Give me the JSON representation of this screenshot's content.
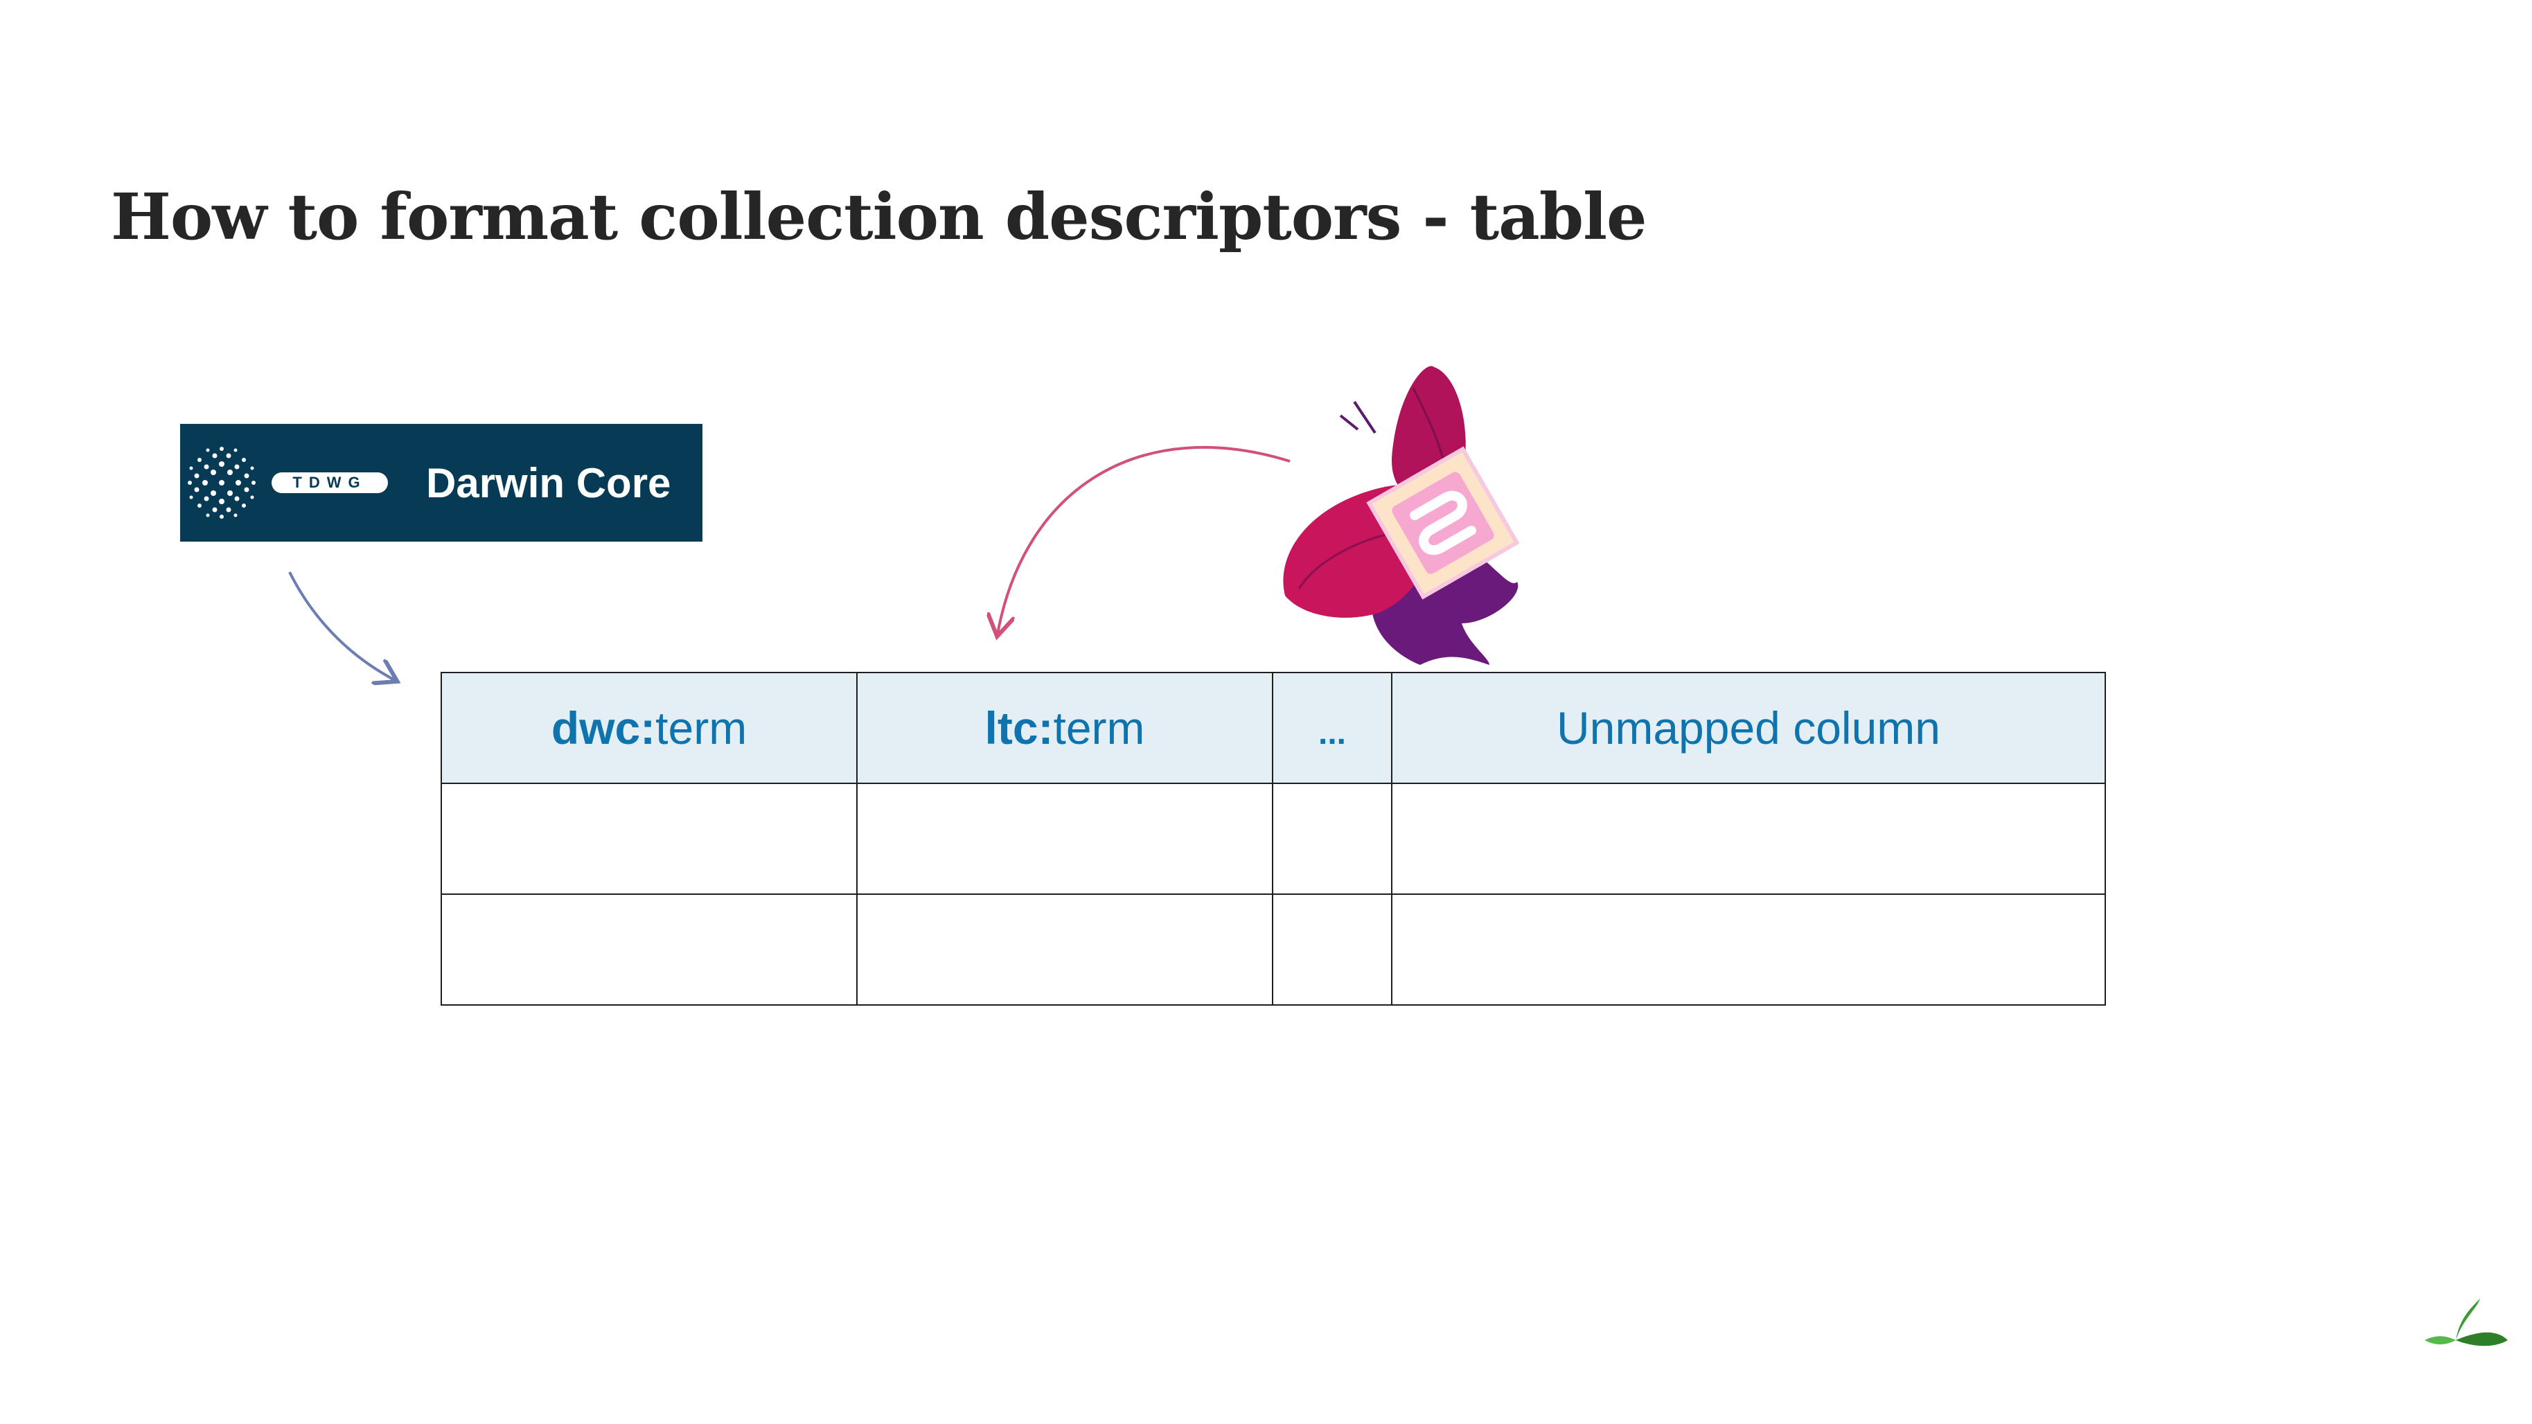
{
  "slide": {
    "title": "How to format collection descriptors - table"
  },
  "dwc_logo": {
    "org_label": "TDWG",
    "name": "Darwin Core",
    "background_color": "#073a55"
  },
  "ltc_logo": {
    "icon": "butterfly-icon"
  },
  "arrows": {
    "dwc_arrow_color": "#6b7db3",
    "ltc_arrow_color": "#d2517a"
  },
  "table": {
    "header_bg_color": "#e3eef5",
    "header_text_color": "#0f74ad",
    "columns": [
      {
        "prefix": "dwc:",
        "suffix": "term"
      },
      {
        "prefix": "ltc:",
        "suffix": "term"
      },
      {
        "prefix": "",
        "suffix": "..."
      },
      {
        "prefix": "",
        "suffix": "Unmapped column"
      }
    ],
    "rows": [
      [
        "",
        "",
        "",
        ""
      ],
      [
        "",
        "",
        "",
        ""
      ]
    ]
  },
  "footer": {
    "icon": "leaf-icon",
    "icon_color": "#3f9b35"
  }
}
